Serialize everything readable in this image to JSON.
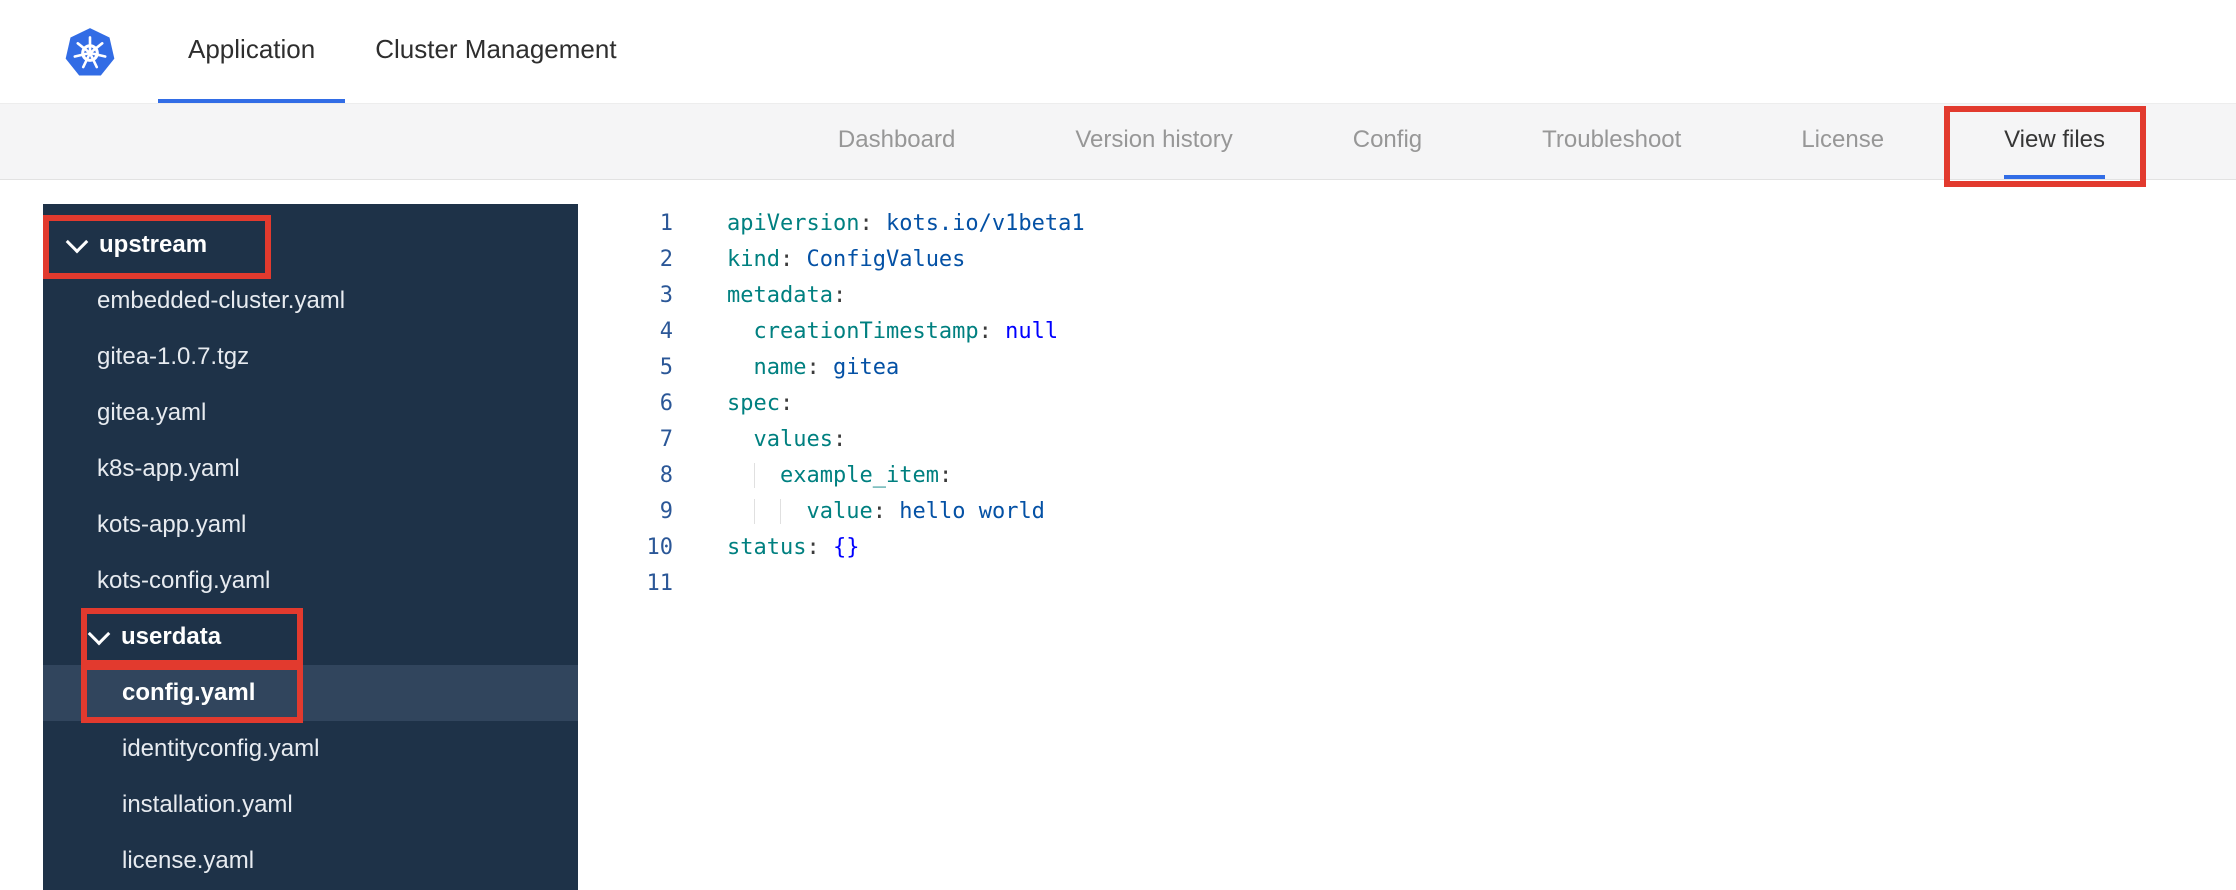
{
  "colors": {
    "accent": "#326de6",
    "annotation": "#e23a2e",
    "sidebar-bg": "#1e3248",
    "sidebar-sel": "#31455d",
    "key": "#008080",
    "val": "#0451a5",
    "kw": "#0000ff",
    "gutter": "#2b5797"
  },
  "header": {
    "tabs": [
      {
        "label": "Application",
        "active": true
      },
      {
        "label": "Cluster Management",
        "active": false
      }
    ]
  },
  "subnav": {
    "items": [
      {
        "label": "Dashboard",
        "active": false
      },
      {
        "label": "Version history",
        "active": false
      },
      {
        "label": "Config",
        "active": false
      },
      {
        "label": "Troubleshoot",
        "active": false
      },
      {
        "label": "License",
        "active": false
      },
      {
        "label": "View files",
        "active": true,
        "annotated": true
      }
    ]
  },
  "file_tree": {
    "items": [
      {
        "type": "folder",
        "label": "upstream",
        "level": 0,
        "expanded": true,
        "annotated": true
      },
      {
        "type": "file",
        "label": "embedded-cluster.yaml",
        "level": 1
      },
      {
        "type": "file",
        "label": "gitea-1.0.7.tgz",
        "level": 1
      },
      {
        "type": "file",
        "label": "gitea.yaml",
        "level": 1
      },
      {
        "type": "file",
        "label": "k8s-app.yaml",
        "level": 1
      },
      {
        "type": "file",
        "label": "kots-app.yaml",
        "level": 1
      },
      {
        "type": "file",
        "label": "kots-config.yaml",
        "level": 1
      },
      {
        "type": "folder",
        "label": "userdata",
        "level": 1,
        "expanded": true,
        "annotated": true
      },
      {
        "type": "file",
        "label": "config.yaml",
        "level": 2,
        "selected": true,
        "annotated": true
      },
      {
        "type": "file",
        "label": "identityconfig.yaml",
        "level": 2
      },
      {
        "type": "file",
        "label": "installation.yaml",
        "level": 2
      },
      {
        "type": "file",
        "label": "license.yaml",
        "level": 2
      }
    ]
  },
  "editor": {
    "lines": [
      {
        "n": "1",
        "tokens": [
          [
            "k",
            "apiVersion"
          ],
          [
            "p",
            ":"
          ],
          [
            "s",
            " "
          ],
          [
            "v",
            "kots.io/v1beta1"
          ]
        ]
      },
      {
        "n": "2",
        "tokens": [
          [
            "k",
            "kind"
          ],
          [
            "p",
            ":"
          ],
          [
            "s",
            " "
          ],
          [
            "v",
            "ConfigValues"
          ]
        ]
      },
      {
        "n": "3",
        "tokens": [
          [
            "k",
            "metadata"
          ],
          [
            "p",
            ":"
          ]
        ]
      },
      {
        "n": "4",
        "tokens": [
          [
            "i",
            "  "
          ],
          [
            "k",
            "creationTimestamp"
          ],
          [
            "p",
            ":"
          ],
          [
            "s",
            " "
          ],
          [
            "w",
            "null"
          ]
        ]
      },
      {
        "n": "5",
        "tokens": [
          [
            "i",
            "  "
          ],
          [
            "k",
            "name"
          ],
          [
            "p",
            ":"
          ],
          [
            "s",
            " "
          ],
          [
            "v",
            "gitea"
          ]
        ]
      },
      {
        "n": "6",
        "tokens": [
          [
            "k",
            "spec"
          ],
          [
            "p",
            ":"
          ]
        ]
      },
      {
        "n": "7",
        "tokens": [
          [
            "i",
            "  "
          ],
          [
            "k",
            "values"
          ],
          [
            "p",
            ":"
          ]
        ]
      },
      {
        "n": "8",
        "tokens": [
          [
            "i",
            "  "
          ],
          [
            "i",
            "  "
          ],
          [
            "k",
            "example_item"
          ],
          [
            "p",
            ":"
          ]
        ]
      },
      {
        "n": "9",
        "tokens": [
          [
            "i",
            "  "
          ],
          [
            "i",
            "  "
          ],
          [
            "i",
            "  "
          ],
          [
            "k",
            "value"
          ],
          [
            "p",
            ":"
          ],
          [
            "s",
            " "
          ],
          [
            "v",
            "hello world"
          ]
        ]
      },
      {
        "n": "10",
        "tokens": [
          [
            "k",
            "status"
          ],
          [
            "p",
            ":"
          ],
          [
            "s",
            " "
          ],
          [
            "w",
            "{}"
          ]
        ]
      },
      {
        "n": "11",
        "tokens": []
      }
    ]
  }
}
